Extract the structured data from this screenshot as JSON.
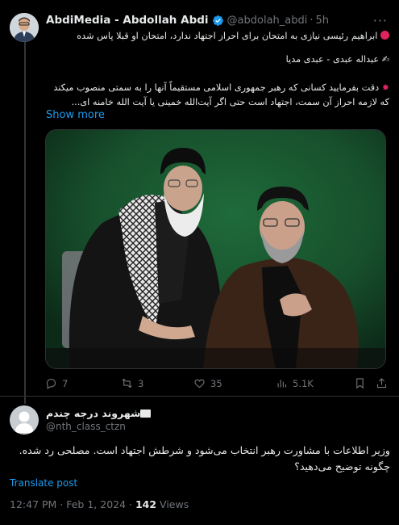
{
  "tweet": {
    "author_name": "AbdiMedia - Abdollah Abdi",
    "handle": "@abdolah_abdi",
    "separator": "·",
    "time": "5h",
    "line1": "ابراهیم رئیسی نیازی به امتحان برای احراز اجتهاد ندارد، امتحان او قبلا پاس شده",
    "line2": "عبداله عبدی - عبدی مدیا",
    "para3": "دقت بفرمایید کسانی که رهبر جمهوری اسلامی مستقیماً آنها را به سمتی منصوب میکند که لازمه احراز آن سمت، اجتهاد است حتی اگر آیت‌الله خمینی یا آیت الله خامنه ای...",
    "show_more": "Show more",
    "icons": {
      "bullet1": "red-circle-emoji",
      "bullet2": "writing-hand-emoji",
      "bullet3": "anger-emoji"
    },
    "actions": {
      "replies": "7",
      "reposts": "3",
      "likes": "35",
      "views": "5.1K"
    }
  },
  "reply": {
    "name": "شهروند درجه چندم",
    "handle": "@nth_class_ctzn",
    "text": "وزیر اطلاعات با مشاورت رهبر انتخاب می‌شود و شرطش اجتهاد است. مصلحی رد شده. چگونه توضیح می‌دهید؟",
    "translate": "Translate post",
    "timestamp": "12:47 PM · Feb 1, 2024 · ",
    "views_count": "142",
    "views_label": " Views"
  },
  "colors": {
    "background": "#000000",
    "text": "#e7e9ea",
    "muted": "#71767b",
    "link": "#1d9bf0",
    "border": "#2f3336",
    "verified": "#1d9bf0"
  }
}
